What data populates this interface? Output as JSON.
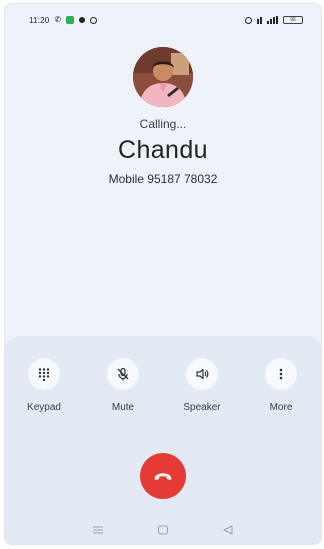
{
  "status_bar": {
    "time": "11:20",
    "battery": "96"
  },
  "call": {
    "status": "Calling...",
    "contact_name": "Chandu",
    "number_label": "Mobile 95187 78032"
  },
  "controls": [
    {
      "label": "Keypad",
      "icon": "keypad-icon"
    },
    {
      "label": "Mute",
      "icon": "mic-off-icon"
    },
    {
      "label": "Speaker",
      "icon": "speaker-icon"
    },
    {
      "label": "More",
      "icon": "more-vertical-icon"
    }
  ],
  "colors": {
    "end_call": "#e63a35",
    "background": "#eef3fa",
    "sheet": "#e3eaf3"
  }
}
